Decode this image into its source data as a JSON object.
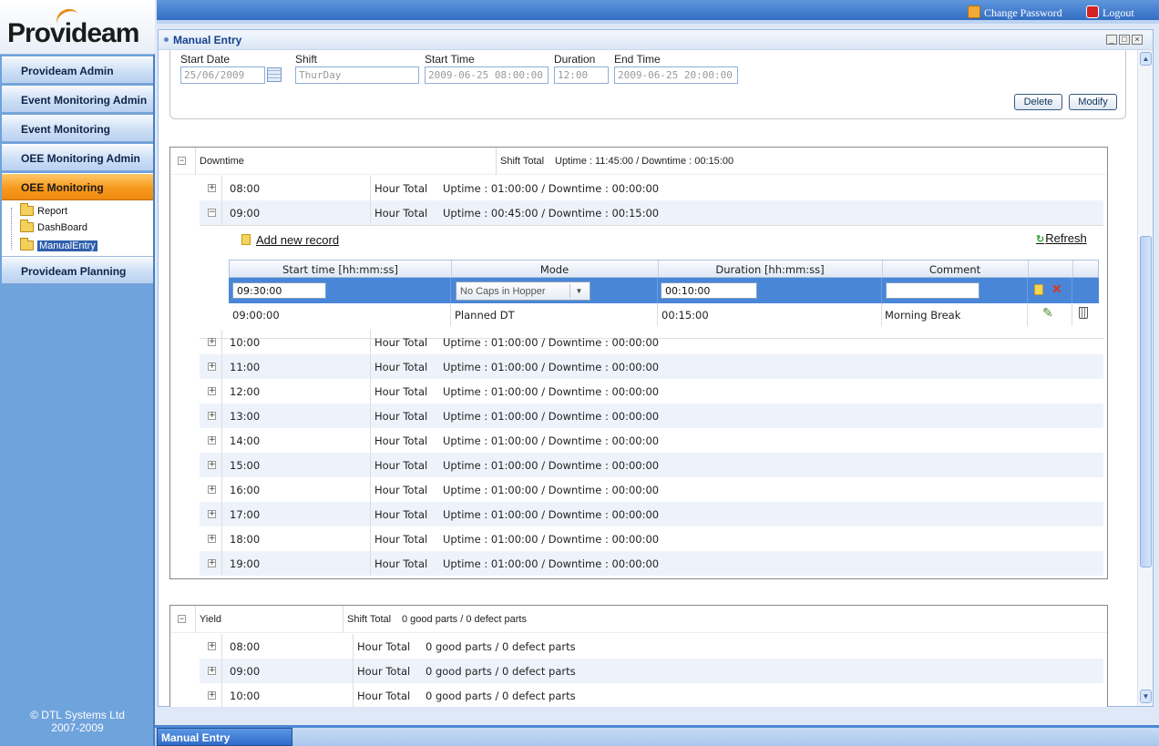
{
  "brand": {
    "logo_text": "Provideam",
    "copyright_line1": "© DTL Systems Ltd",
    "copyright_line2": "2007-2009"
  },
  "nav": {
    "items": [
      {
        "label": "Provideam Admin"
      },
      {
        "label": "Event Monitoring Admin"
      },
      {
        "label": "Event Monitoring"
      },
      {
        "label": "OEE Monitoring Admin"
      },
      {
        "label": "OEE Monitoring"
      },
      {
        "label": "Provideam Planning"
      }
    ],
    "tree": [
      {
        "label": "Report"
      },
      {
        "label": "DashBoard"
      },
      {
        "label": "ManualEntry"
      }
    ]
  },
  "topbar": {
    "change_password": "Change Password",
    "logout": "Logout"
  },
  "panel": {
    "title": "Manual Entry"
  },
  "form": {
    "start_date_label": "Start Date",
    "start_date": "25/06/2009",
    "shift_label": "Shift",
    "shift": "ThurDay",
    "start_time_label": "Start Time",
    "start_time": "2009-06-25 08:00:00",
    "duration_label": "Duration",
    "duration": "12:00",
    "end_time_label": "End Time",
    "end_time": "2009-06-25 20:00:00",
    "delete_label": "Delete",
    "modify_label": "Modify"
  },
  "downtime": {
    "name": "Downtime",
    "shift_total_label": "Shift Total",
    "shift_total": "Uptime : 11:45:00 / Downtime : 00:15:00",
    "hour_total_label": "Hour Total",
    "rows": [
      {
        "time": "08:00",
        "value": "Uptime : 01:00:00 / Downtime : 00:00:00"
      },
      {
        "time": "09:00",
        "value": "Uptime : 00:45:00 / Downtime : 00:15:00"
      },
      {
        "time": "10:00",
        "value": "Uptime : 01:00:00 / Downtime : 00:00:00"
      },
      {
        "time": "11:00",
        "value": "Uptime : 01:00:00 / Downtime : 00:00:00"
      },
      {
        "time": "12:00",
        "value": "Uptime : 01:00:00 / Downtime : 00:00:00"
      },
      {
        "time": "13:00",
        "value": "Uptime : 01:00:00 / Downtime : 00:00:00"
      },
      {
        "time": "14:00",
        "value": "Uptime : 01:00:00 / Downtime : 00:00:00"
      },
      {
        "time": "15:00",
        "value": "Uptime : 01:00:00 / Downtime : 00:00:00"
      },
      {
        "time": "16:00",
        "value": "Uptime : 01:00:00 / Downtime : 00:00:00"
      },
      {
        "time": "17:00",
        "value": "Uptime : 01:00:00 / Downtime : 00:00:00"
      },
      {
        "time": "18:00",
        "value": "Uptime : 01:00:00 / Downtime : 00:00:00"
      },
      {
        "time": "19:00",
        "value": "Uptime : 01:00:00 / Downtime : 00:00:00"
      }
    ],
    "detail": {
      "add_new": "Add new record",
      "refresh": "Refresh",
      "columns": [
        "Start time [hh:mm:ss]",
        "Mode",
        "Duration [hh:mm:ss]",
        "Comment"
      ],
      "edit": {
        "start": "09:30:00",
        "mode": "No Caps in Hopper",
        "duration": "00:10:00",
        "comment": ""
      },
      "record": {
        "start": "09:00:00",
        "mode": "Planned DT",
        "duration": "00:15:00",
        "comment": "Morning Break"
      }
    }
  },
  "yield": {
    "name": "Yield",
    "shift_total_label": "Shift Total",
    "shift_total": "0 good parts / 0 defect parts",
    "hour_total_label": "Hour Total",
    "rows": [
      {
        "time": "08:00",
        "value": "0 good parts / 0 defect parts"
      },
      {
        "time": "09:00",
        "value": "0 good parts / 0 defect parts"
      },
      {
        "time": "10:00",
        "value": "0 good parts / 0 defect parts"
      }
    ]
  },
  "footer": {
    "tab": "Manual Entry"
  },
  "colors": {
    "accent": "#f08a10",
    "header_blue": "#2d68c0",
    "selected_row": "#4a86d8"
  }
}
